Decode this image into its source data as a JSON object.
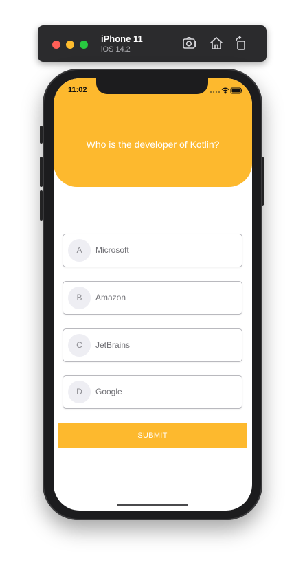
{
  "simulator": {
    "device_name": "iPhone 11",
    "os_version": "iOS 14.2",
    "toolbar_icons": [
      "screenshot-icon",
      "home-icon",
      "rotate-icon"
    ]
  },
  "status_bar": {
    "time": "11:02",
    "icons": [
      "cellular-icon",
      "wifi-icon",
      "battery-icon"
    ]
  },
  "quiz": {
    "question": "Who is the developer of Kotlin?",
    "options": [
      {
        "letter": "A",
        "text": "Microsoft"
      },
      {
        "letter": "B",
        "text": "Amazon"
      },
      {
        "letter": "C",
        "text": "JetBrains"
      },
      {
        "letter": "D",
        "text": "Google"
      }
    ],
    "submit_label": "SUBMIT"
  },
  "colors": {
    "accent": "#fdb92e",
    "option_border": "#b9b9be",
    "badge_bg": "#eeeef3"
  }
}
